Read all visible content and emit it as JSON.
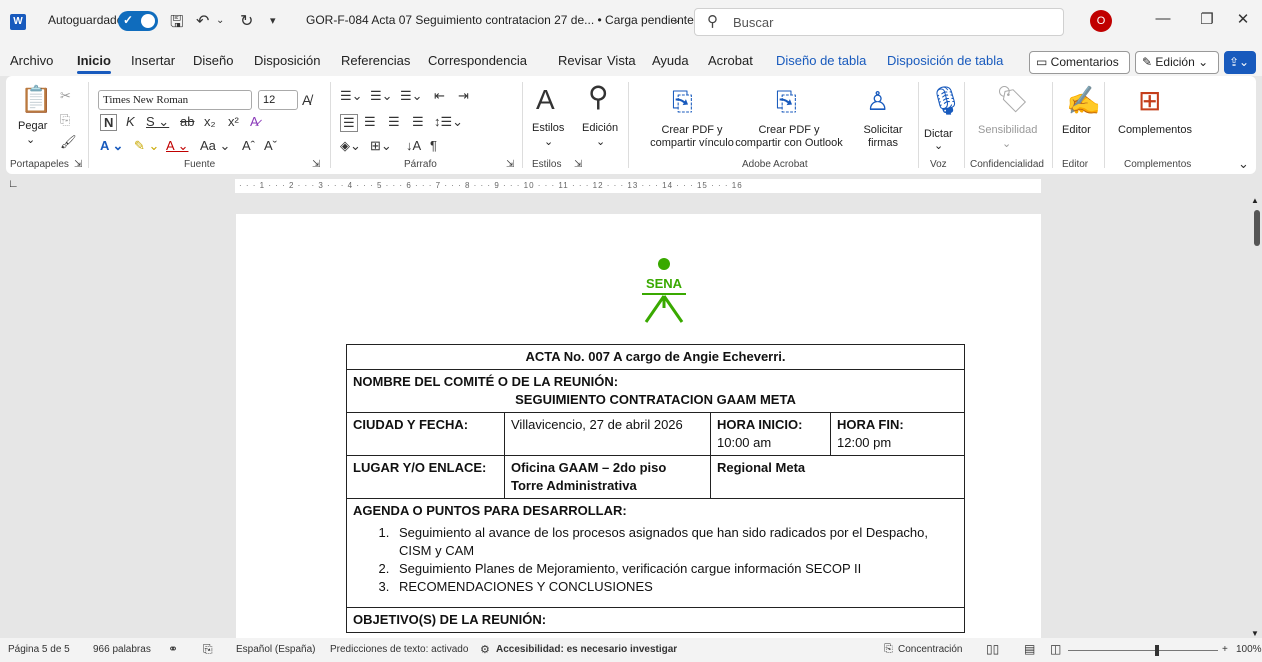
{
  "titlebar": {
    "autosave_label": "Autoguardado",
    "document_title": "GOR-F-084 Acta 07 Seguimiento contratacion 27 de... • Carga pendiente",
    "search_placeholder": "Buscar",
    "user_initial": "O",
    "app_icon": "word-icon"
  },
  "menu": {
    "tabs": [
      "Archivo",
      "Inicio",
      "Insertar",
      "Diseño",
      "Disposición",
      "Referencias",
      "Correspondencia",
      "Revisar",
      "Vista",
      "Ayuda",
      "Acrobat",
      "Diseño de tabla",
      "Disposición de tabla"
    ],
    "active_tab": "Inicio",
    "comments_label": "Comentarios",
    "editing_label": "Edición"
  },
  "ribbon": {
    "clipboard": {
      "paste_label": "Pegar",
      "group_label": "Portapapeles"
    },
    "font": {
      "font_name": "Times New Roman",
      "font_size": "12",
      "group_label": "Fuente",
      "case_label": "Aa"
    },
    "paragraph": {
      "group_label": "Párrafo"
    },
    "styles": {
      "label": "Estilos",
      "group_label": "Estilos"
    },
    "editing": {
      "label": "Edición"
    },
    "acrobat": {
      "create_pdf_share": "Crear PDF y compartir vínculo",
      "create_pdf_outlook": "Crear PDF y compartir con Outlook",
      "request_signatures": "Solicitar firmas",
      "group_label": "Adobe Acrobat"
    },
    "voice": {
      "dictate_label": "Dictar",
      "group_label": "Voz"
    },
    "sensitivity": {
      "label": "Sensibilidad",
      "group_label": "Confidencialidad"
    },
    "editor": {
      "label": "Editor",
      "group_label": "Editor"
    },
    "addins": {
      "label": "Complementos",
      "group_label": "Complementos"
    }
  },
  "ruler": {
    "marks": "· · · 1 · · · 2 · · · 3 · · · 4 · · · 5 · · · 6 · · · 7 · · · 8 · · · 9 · · · 10 · · · 11 · · · 12 · · · 13 · · · 14 · · · 15 · · · 16"
  },
  "document": {
    "logo_text": "SENA",
    "acta_title": "ACTA No. 007 A cargo de Angie Echeverri.",
    "committee_label": "NOMBRE DEL COMITÉ O DE LA REUNIÓN:",
    "committee_name": "SEGUIMIENTO CONTRATACION GAAM META",
    "city_date_label": "CIUDAD Y FECHA:",
    "city_date_value": "Villavicencio, 27 de abril 2026",
    "start_label": "HORA INICIO:",
    "start_value": "10:00 am",
    "end_label": "HORA FIN:",
    "end_value": "12:00 pm",
    "place_label": "LUGAR Y/O ENLACE:",
    "place_value_1": "Oficina GAAM – 2do piso",
    "place_value_2": "Torre Administrativa",
    "regional": "Regional Meta",
    "agenda_label": "AGENDA O PUNTOS PARA DESARROLLAR:",
    "agenda_items": [
      "Seguimiento al avance de los procesos asignados que han sido radicados por el Despacho, CISM y CAM",
      "Seguimiento Planes de Mejoramiento, verificación cargue información SECOP II",
      "RECOMENDACIONES Y CONCLUSIONES"
    ],
    "objective_label": "OBJETIVO(S) DE LA REUNIÓN:"
  },
  "status": {
    "page": "Página 5 de 5",
    "words": "966 palabras",
    "language": "Español (España)",
    "predictions": "Predicciones de texto: activado",
    "accessibility": "Accesibilidad: es necesario investigar",
    "focus": "Concentración",
    "zoom": "100%"
  },
  "colors": {
    "accent": "#185abd",
    "sena_green": "#39a900"
  }
}
